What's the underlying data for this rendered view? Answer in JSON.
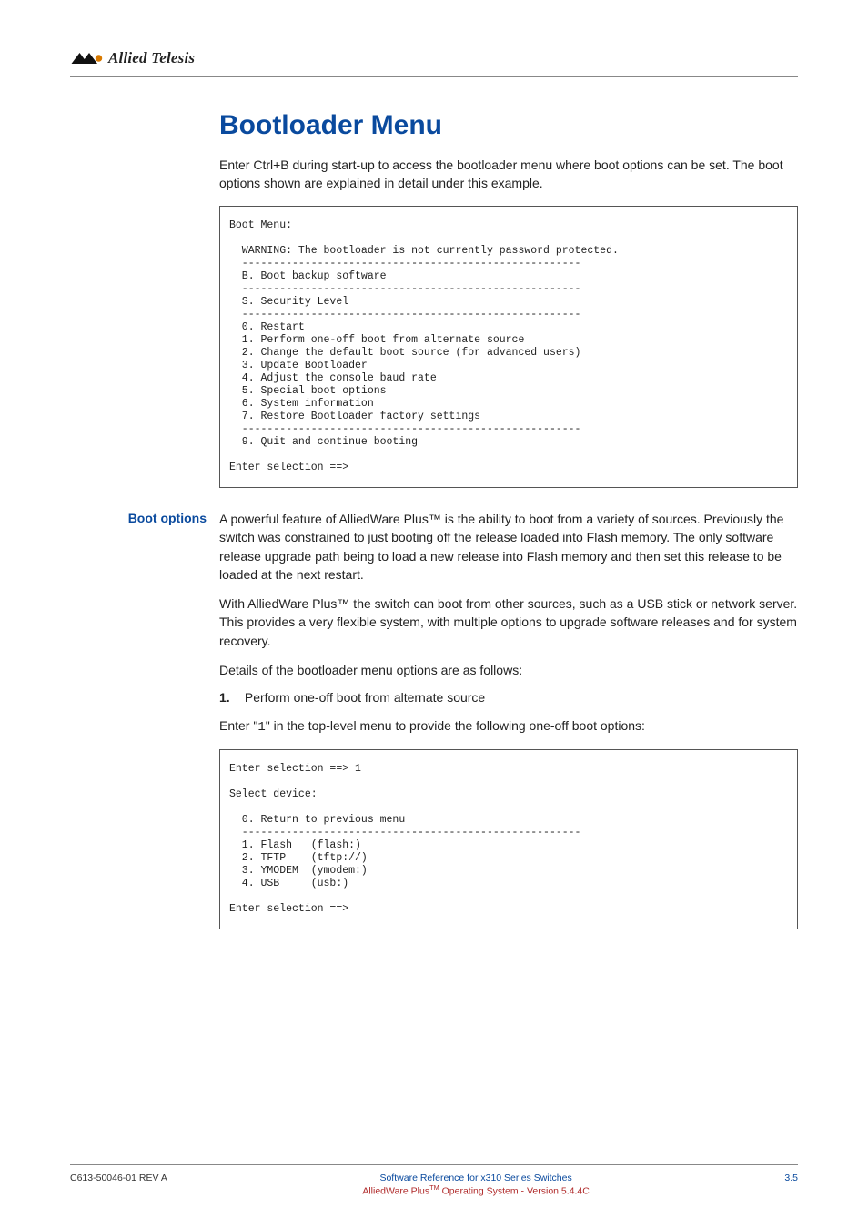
{
  "header": {
    "brand": "Allied Telesis"
  },
  "title": "Bootloader Menu",
  "intro": "Enter Ctrl+B during start-up to access the bootloader menu where boot options can be set. The boot options shown are explained in detail under this example.",
  "code1": "Boot Menu:\n\n  WARNING: The bootloader is not currently password protected.\n  ------------------------------------------------------\n  B. Boot backup software\n  ------------------------------------------------------\n  S. Security Level\n  ------------------------------------------------------\n  0. Restart\n  1. Perform one-off boot from alternate source\n  2. Change the default boot source (for advanced users)\n  3. Update Bootloader\n  4. Adjust the console baud rate\n  5. Special boot options\n  6. System information\n  7. Restore Bootloader factory settings\n  ------------------------------------------------------\n  9. Quit and continue booting\n\nEnter selection ==>",
  "boot_options": {
    "label": "Boot options",
    "p1": "A powerful feature of AlliedWare Plus™ is the ability to boot from a variety of sources. Previously the switch was constrained to just booting off the release loaded into Flash memory. The only software release upgrade path being to load a new release into Flash memory and then set this release to be loaded at the next restart.",
    "p2": "With AlliedWare Plus™ the switch can boot from other sources, such as a USB stick or network server. This provides a very flexible system, with multiple options to upgrade software releases and for system recovery.",
    "p3": "Details of the bootloader menu options are as follows:",
    "step1_num": "1.",
    "step1_text": "Perform one-off boot from alternate source",
    "p4_a": "Enter \"",
    "p4_mono": "1",
    "p4_b": "\" in the top-level menu to provide the following one-off boot options:"
  },
  "code2": "Enter selection ==> 1\n\nSelect device:\n\n  0. Return to previous menu\n  ------------------------------------------------------\n  1. Flash   (flash:)\n  2. TFTP    (tftp://)\n  3. YMODEM  (ymodem:)\n  4. USB     (usb:)\n\nEnter selection ==>",
  "footer": {
    "left": "C613-50046-01 REV A",
    "center1": "Software Reference for x310 Series Switches",
    "center2a": "AlliedWare Plus",
    "center2b": " Operating System - Version 5.4.4C",
    "right": "3.5"
  }
}
